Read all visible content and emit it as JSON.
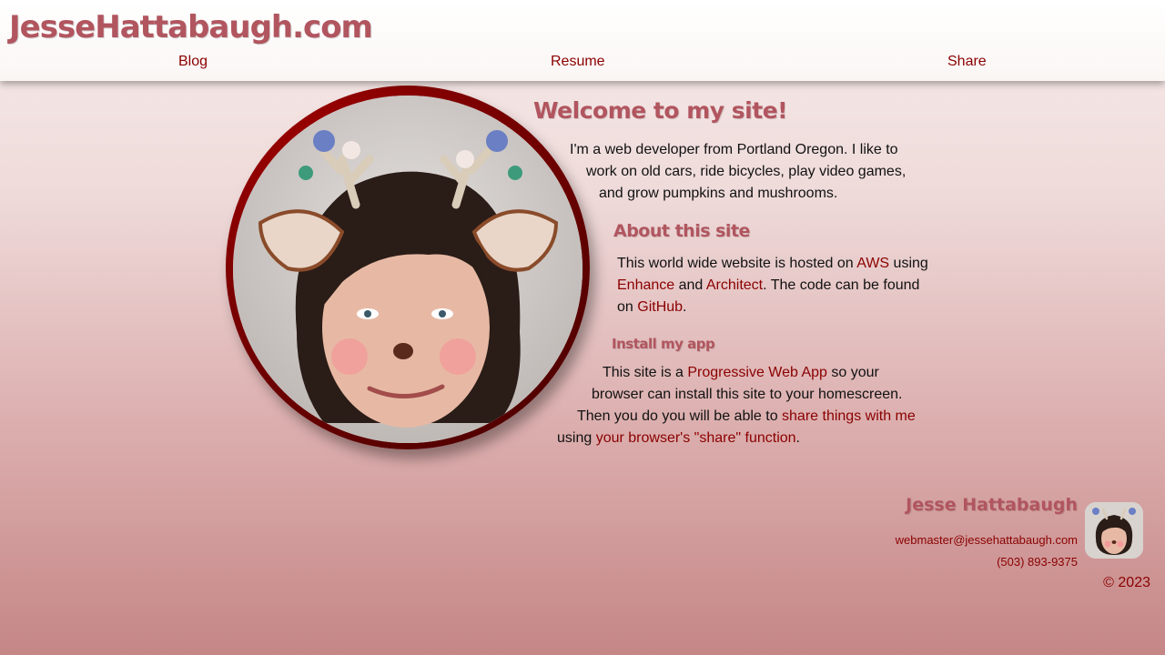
{
  "header": {
    "site_title": "JesseHattabaugh.com",
    "nav": [
      {
        "label": "Blog"
      },
      {
        "label": "Resume"
      },
      {
        "label": "Share"
      }
    ]
  },
  "main": {
    "welcome_heading": "Welcome to my site!",
    "intro_lines": [
      "I'm a web developer from Portland Oregon. I like to",
      "work on old cars, ride bicycles, play video games,",
      "and grow pumpkins and mushrooms."
    ],
    "about_heading": "About this site",
    "about": {
      "t1": "This world wide website is hosted on ",
      "aws": "AWS",
      "t2": " using",
      "enhance": "Enhance",
      "t3": " and ",
      "architect": "Architect",
      "t4": ". The code can be found",
      "t5": "on ",
      "github": "GitHub",
      "t6": "."
    },
    "install_heading": "Install my app",
    "install": {
      "t1": "This site is a ",
      "pwa": "Progressive Web App",
      "t2": " so your",
      "line2": "browser can install this site to your homescreen.",
      "t3": "Then you do you will be able to ",
      "share_things": "share things with me",
      "t4": "using ",
      "share_fn": "your browser's \"share\" function",
      "t5": "."
    }
  },
  "footer": {
    "name": "Jesse Hattabaugh",
    "email": "webmaster@jessehattabaugh.com",
    "phone": "(503) 893-9375",
    "copyright": "© 2023"
  },
  "colors": {
    "link": "#8b0000",
    "heading": "#b1555f",
    "avatar_ring": "#8b0000"
  },
  "icons": [
    "profile-photo",
    "footer-avatar"
  ]
}
